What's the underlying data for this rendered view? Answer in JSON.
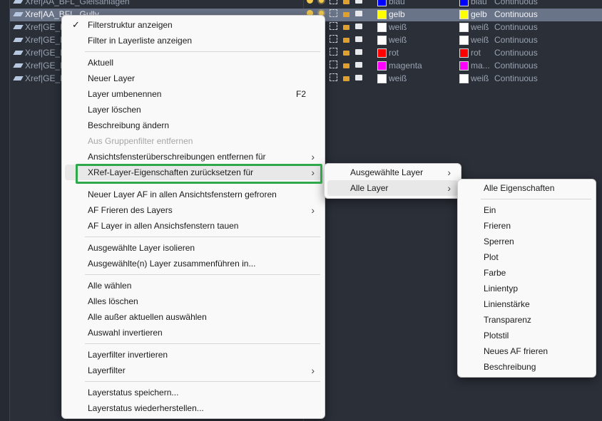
{
  "layers": [
    {
      "name": "Xref|AA_BFL_Gleisanlagen",
      "c1": "#0000ff",
      "c1name": "blau",
      "c2": "#0000ff",
      "c2name": "blau",
      "ltype": "Continuous",
      "sel": false
    },
    {
      "name": "Xref|AA_BFL_Gully",
      "c1": "#ffff00",
      "c1name": "gelb",
      "c2": "#ffff00",
      "c2name": "gelb",
      "ltype": "Continuous",
      "sel": true
    },
    {
      "name": "Xref|GE_M",
      "c1": "#ffffff",
      "c1name": "weiß",
      "c2": "#ffffff",
      "c2name": "weiß",
      "ltype": "Continuous",
      "sel": false
    },
    {
      "name": "Xref|GE_M",
      "c1": "#ffffff",
      "c1name": "weiß",
      "c2": "#ffffff",
      "c2name": "weiß",
      "ltype": "Continuous",
      "sel": false
    },
    {
      "name": "Xref|GE_M",
      "c1": "#ff0000",
      "c1name": "rot",
      "c2": "#ff0000",
      "c2name": "rot",
      "ltype": "Continuous",
      "sel": false
    },
    {
      "name": "Xref|GE_M",
      "c1": "#ff00ff",
      "c1name": "magenta",
      "c2": "#ff00ff",
      "c2name": "ma...",
      "ltype": "Continuous",
      "sel": false
    },
    {
      "name": "Xref|GE_M",
      "c1": "#ffffff",
      "c1name": "weiß",
      "c2": "#ffffff",
      "c2name": "weiß",
      "ltype": "Continuous",
      "sel": false
    }
  ],
  "main_menu": [
    {
      "label": "Filterstruktur anzeigen",
      "checked": true
    },
    {
      "label": "Filter in Layerliste anzeigen"
    },
    {
      "sep": true
    },
    {
      "label": "Aktuell"
    },
    {
      "label": "Neuer Layer"
    },
    {
      "label": "Layer umbenennen",
      "shortcut": "F2"
    },
    {
      "label": "Layer löschen"
    },
    {
      "label": "Beschreibung ändern"
    },
    {
      "label": "Aus Gruppenfilter entfernen",
      "disabled": true
    },
    {
      "label": "Ansichtsfensterüberschreibungen entfernen für",
      "sub": true
    },
    {
      "label": "XRef-Layer-Eigenschaften zurücksetzen für",
      "sub": true,
      "highlight": true
    },
    {
      "sep": true
    },
    {
      "label": "Neuer Layer AF in allen Ansichtsfenstern gefroren"
    },
    {
      "label": "AF Frieren des Layers",
      "sub": true
    },
    {
      "label": "AF Layer in allen Ansichsfenstern tauen"
    },
    {
      "sep": true
    },
    {
      "label": "Ausgewählte Layer isolieren"
    },
    {
      "label": "Ausgewählte(n) Layer zusammenführen in..."
    },
    {
      "sep": true
    },
    {
      "label": "Alle wählen"
    },
    {
      "label": "Alles löschen"
    },
    {
      "label": "Alle außer aktuellen auswählen"
    },
    {
      "label": "Auswahl invertieren"
    },
    {
      "sep": true
    },
    {
      "label": "Layerfilter invertieren"
    },
    {
      "label": "Layerfilter",
      "sub": true
    },
    {
      "sep": true
    },
    {
      "label": "Layerstatus speichern..."
    },
    {
      "label": "Layerstatus wiederherstellen..."
    }
  ],
  "sub_menu_1": [
    {
      "label": "Ausgewählte Layer",
      "sub": true
    },
    {
      "label": "Alle Layer",
      "sub": true,
      "highlight": true
    }
  ],
  "sub_menu_2": [
    {
      "label": "Alle Eigenschaften"
    },
    {
      "sep": true
    },
    {
      "label": "Ein"
    },
    {
      "label": "Frieren"
    },
    {
      "label": "Sperren"
    },
    {
      "label": "Plot"
    },
    {
      "label": "Farbe"
    },
    {
      "label": "Linientyp"
    },
    {
      "label": "Linienstärke"
    },
    {
      "label": "Transparenz"
    },
    {
      "label": "Plotstil"
    },
    {
      "label": "Neues AF frieren"
    },
    {
      "label": "Beschreibung"
    }
  ],
  "arrow_glyph": "›",
  "check_glyph": "✓",
  "accent_color": "#2ea84a"
}
